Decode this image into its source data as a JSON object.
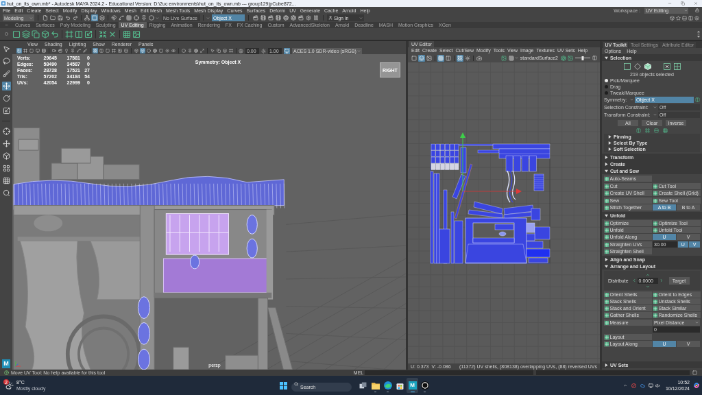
{
  "title_bar": {
    "title": "hut_on_its_own.mb* - Autodesk MAYA 2024.2 - Educational Version: D:\\2uc environments\\hut_on_its_own.mb --- group129|pCube872..."
  },
  "menu_bar": {
    "items": [
      "File",
      "Edit",
      "Create",
      "Select",
      "Modify",
      "Display",
      "Windows",
      "Mesh",
      "Edit Mesh",
      "Mesh Tools",
      "Mesh Display",
      "Curves",
      "Surfaces",
      "Deform",
      "UV",
      "Generate",
      "Cache",
      "Arnold",
      "Help"
    ],
    "workspace": {
      "label": "Workspace :",
      "value": "UV Editing"
    }
  },
  "status_line": {
    "mode": "Modeling",
    "tool_groups": [
      [
        {
          "kind": "file",
          "selected": false
        },
        {
          "kind": "folder",
          "selected": false
        },
        {
          "kind": "save",
          "selected": false
        },
        {
          "kind": "undo",
          "selected": false
        },
        {
          "kind": "redo",
          "selected": false
        }
      ],
      [
        {
          "kind": "hierarchy",
          "selected": false
        },
        {
          "kind": "square",
          "selected": true
        },
        {
          "kind": "layers",
          "selected": false
        }
      ],
      [
        {
          "kind": "magnet",
          "selected": false
        },
        {
          "kind": "spline",
          "selected": false
        },
        {
          "kind": "grid",
          "selected": false
        },
        {
          "kind": "crosshair",
          "selected": false
        },
        {
          "kind": "pin",
          "selected": false
        },
        {
          "kind": "circle",
          "selected": false
        }
      ]
    ],
    "live_surface": "No Live Surface",
    "symmetry": "Object X",
    "render_groups": [
      [
        {
          "kind": "clapper",
          "selected": false
        },
        {
          "kind": "film",
          "selected": false
        },
        {
          "kind": "clapper",
          "selected": false
        },
        {
          "kind": "film",
          "selected": false
        },
        {
          "kind": "aperture",
          "selected": false
        },
        {
          "kind": "aperture",
          "selected": false
        },
        {
          "kind": "clapper",
          "selected": false
        },
        {
          "kind": "gear",
          "selected": false
        },
        {
          "kind": "pause",
          "selected": false
        }
      ]
    ],
    "account": "Sign in"
  },
  "shelf": {
    "tabs": [
      {
        "label": "Curves",
        "selected": false
      },
      {
        "label": "Surfaces",
        "selected": false
      },
      {
        "label": "Poly Modeling",
        "selected": false
      },
      {
        "label": "Sculpting",
        "selected": false
      },
      {
        "label": "UV Editing",
        "selected": true
      },
      {
        "label": "Rigging",
        "selected": false
      },
      {
        "label": "Animation",
        "selected": false
      },
      {
        "label": "Rendering",
        "selected": false
      },
      {
        "label": "FX",
        "selected": false
      },
      {
        "label": "FX Caching",
        "selected": false
      },
      {
        "label": "Custom",
        "selected": false
      },
      {
        "label": "AdvancedSkeleton",
        "selected": false
      },
      {
        "label": "Arnold",
        "selected": false
      },
      {
        "label": "Deadline",
        "selected": false
      },
      {
        "label": "MASH",
        "selected": false
      },
      {
        "label": "Motion Graphics",
        "selected": false
      },
      {
        "label": "XGen",
        "selected": false
      }
    ]
  },
  "toolbox": {
    "tool_groups": [
      [
        {
          "kind": "pointer",
          "selected": false
        },
        {
          "kind": "lasso",
          "selected": false
        },
        {
          "kind": "brush",
          "selected": false
        },
        {
          "kind": "move",
          "selected": true
        },
        {
          "kind": "rotate",
          "selected": false
        },
        {
          "kind": "scale",
          "selected": false
        }
      ],
      [
        {
          "kind": "crosshair",
          "selected": false
        },
        {
          "kind": "move",
          "selected": false
        },
        {
          "kind": "cube",
          "selected": false
        },
        {
          "kind": "layout",
          "selected": false
        },
        {
          "kind": "grid",
          "selected": false
        },
        {
          "kind": "search",
          "selected": false
        }
      ]
    ],
    "logo_letter": "M"
  },
  "viewport": {
    "menu": [
      "View",
      "Shading",
      "Lighting",
      "Show",
      "Renderer",
      "Panels"
    ],
    "tool_groups": [
      [
        {
          "kind": "image",
          "selected": true
        },
        {
          "kind": "frame",
          "selected": false
        },
        {
          "kind": "square",
          "selected": false
        },
        {
          "kind": "monitor",
          "selected": false
        },
        {
          "kind": "film",
          "selected": false
        }
      ],
      [
        {
          "kind": "video",
          "selected": false
        },
        {
          "kind": "clapper",
          "selected": false
        },
        {
          "kind": "bulb",
          "selected": false
        },
        {
          "kind": "pin",
          "selected": false
        },
        {
          "kind": "spline",
          "selected": false
        },
        {
          "kind": "brush",
          "selected": false
        }
      ],
      [
        {
          "kind": "layout",
          "selected": true
        },
        {
          "kind": "columns",
          "selected": false
        },
        {
          "kind": "square",
          "selected": false
        },
        {
          "kind": "frame",
          "selected": false
        },
        {
          "kind": "image",
          "selected": false
        },
        {
          "kind": "rows",
          "selected": false
        }
      ],
      [
        {
          "kind": "cube",
          "selected": false
        },
        {
          "kind": "cube",
          "selected": true
        },
        {
          "kind": "circle",
          "selected": false
        },
        {
          "kind": "aperture",
          "selected": false
        },
        {
          "kind": "square",
          "selected": false
        },
        {
          "kind": "sun",
          "selected": false
        },
        {
          "kind": "eye",
          "selected": false
        }
      ],
      [
        {
          "kind": "circle",
          "selected": false
        },
        {
          "kind": "pin",
          "selected": false
        },
        {
          "kind": "aperture",
          "selected": false
        },
        {
          "kind": "maximize",
          "selected": false
        }
      ],
      [
        {
          "kind": "pointer",
          "selected": false
        },
        {
          "kind": "copy",
          "selected": false
        },
        {
          "kind": "layers",
          "selected": false
        },
        {
          "kind": "frame",
          "selected": false
        }
      ]
    ],
    "exposure": "0.00",
    "gamma": "1.00",
    "color_management": {
      "on": true,
      "value": "ACES 1.0 SDR-video (sRGB)"
    },
    "hud": [
      {
        "label": "Verts:",
        "values": [
          "29645",
          "17581",
          "0"
        ]
      },
      {
        "label": "Edges:",
        "values": [
          "58490",
          "34587",
          "0"
        ]
      },
      {
        "label": "Faces:",
        "values": [
          "28728",
          "17521",
          "27"
        ]
      },
      {
        "label": "Tris:",
        "values": [
          "57202",
          "34184",
          "54"
        ]
      },
      {
        "label": "UVs:",
        "values": [
          "42054",
          "22999",
          "0"
        ]
      }
    ],
    "symmetry": "Symmetry: Object X",
    "view_cube": "RIGHT",
    "camera": "persp"
  },
  "uv_editor": {
    "tab": "UV Editor",
    "menu": [
      "Edit",
      "Create",
      "Select",
      "Cut/Sew",
      "Modify",
      "Tools",
      "View",
      "Image",
      "Textures",
      "UV Sets",
      "Help"
    ],
    "tool_groups": [
      [
        {
          "kind": "square",
          "selected": false
        },
        {
          "kind": "layers",
          "selected": true
        },
        {
          "kind": "image",
          "selected": false
        }
      ],
      [
        {
          "kind": "grid",
          "selected": true
        },
        {
          "kind": "columns",
          "selected": false
        }
      ],
      [
        {
          "kind": "layout",
          "selected": true
        },
        {
          "kind": "sun",
          "selected": false
        }
      ],
      [
        {
          "kind": "camera",
          "selected": false
        }
      ]
    ],
    "material": "standardSurface2",
    "brightness": {
      "level": 0.5
    },
    "u_coordinate": "U: 0.373",
    "v_coordinate": "V: -0.086",
    "info": "(11372) UV shells, (808138) overlapping UVs, (88) reversed UVs"
  },
  "uv_toolkit": {
    "tabs": [
      {
        "label": "UV Toolkit",
        "selected": true
      },
      {
        "label": "Tool Settings",
        "selected": false
      },
      {
        "label": "Attribute Editor",
        "selected": false
      }
    ],
    "menu": [
      "Options",
      "Help"
    ],
    "selection": {
      "title": "Selection",
      "expanded": true,
      "modes": [
        {
          "kind": "square",
          "selected": false
        },
        {
          "kind": "diamond",
          "selected": false
        },
        {
          "kind": "cube",
          "selected": true
        },
        {
          "kind": "shell",
          "selected": false
        },
        {
          "kind": "grid",
          "selected": false
        }
      ],
      "status": "219 objects selected",
      "pick_modes": [
        {
          "label": "Pick/Marquee",
          "selected": true
        },
        {
          "label": "Drag",
          "selected": false
        },
        {
          "label": "Tweak/Marquee",
          "selected": false
        }
      ],
      "symmetry": {
        "label": "Symmetry:",
        "value": "Object X"
      },
      "constraints": [
        {
          "label": "Selection Constraint:",
          "value": "Off"
        },
        {
          "label": "Transform Constraint:",
          "value": "Off"
        }
      ],
      "buttons": [
        "All",
        "Clear",
        "Inverse"
      ],
      "subsections": [
        {
          "title": "Pinning",
          "expanded": false
        },
        {
          "title": "Select By Type",
          "expanded": false
        },
        {
          "title": "Soft Selection",
          "expanded": false
        }
      ]
    },
    "sections": [
      {
        "title": "Transform",
        "expanded": false
      },
      {
        "title": "Create",
        "expanded": false
      },
      {
        "title": "Cut and Sew",
        "expanded": true,
        "groups": [
          [
            [
              {
                "kind": "tool",
                "label": "Auto-Seams"
              }
            ]
          ],
          [
            [
              {
                "kind": "tool",
                "label": "Cut"
              },
              {
                "kind": "tool",
                "label": "Cut Tool"
              }
            ],
            [
              {
                "kind": "tool",
                "label": "Create UV Shell"
              },
              {
                "kind": "tool",
                "label": "Create Shell (Grid)"
              }
            ]
          ],
          [
            [
              {
                "kind": "tool",
                "label": "Sew"
              },
              {
                "kind": "tool",
                "label": "Sew Tool"
              }
            ],
            [
              {
                "kind": "tool",
                "label": "Stitch Together"
              },
              {
                "kind": "toggle",
                "label": "A to B",
                "selected": true
              },
              {
                "kind": "toggle",
                "label": "B to A",
                "selected": false
              }
            ]
          ]
        ]
      },
      {
        "title": "Unfold",
        "expanded": true,
        "groups": [
          [
            [
              {
                "kind": "tool",
                "label": "Optimize"
              },
              {
                "kind": "tool",
                "label": "Optimize Tool"
              }
            ],
            [
              {
                "kind": "tool",
                "label": "Unfold"
              },
              {
                "kind": "tool",
                "label": "Unfold Tool"
              }
            ],
            [
              {
                "kind": "tool",
                "label": "Unfold Along"
              },
              {
                "kind": "toggle",
                "label": "U",
                "selected": true
              },
              {
                "kind": "toggle",
                "label": "V",
                "selected": false
              }
            ]
          ],
          [
            [
              {
                "kind": "tool",
                "label": "Straighten UVs"
              },
              {
                "kind": "field",
                "value": "30.00"
              },
              {
                "kind": "toggle",
                "label": "U",
                "selected": true
              },
              {
                "kind": "toggle",
                "label": "V",
                "selected": true
              }
            ],
            [
              {
                "kind": "tool",
                "label": "Straighten Shell"
              }
            ]
          ]
        ]
      },
      {
        "title": "Align and Snap",
        "expanded": false
      },
      {
        "title": "Arrange and Layout",
        "expanded": true,
        "groups": [
          [
            [
              {
                "kind": "distribute",
                "label": "Distribute",
                "value": "0.0000",
                "button": "Target"
              }
            ]
          ],
          [
            [
              {
                "kind": "tool",
                "label": "Orient Shells"
              },
              {
                "kind": "tool",
                "label": "Orient to Edges"
              }
            ],
            [
              {
                "kind": "tool",
                "label": "Stack Shells"
              },
              {
                "kind": "tool",
                "label": "Unstack Shells"
              }
            ],
            [
              {
                "kind": "tool",
                "label": "Stack and Orient"
              },
              {
                "kind": "tool",
                "label": "Stack Similar"
              }
            ],
            [
              {
                "kind": "tool",
                "label": "Gather Shells"
              },
              {
                "kind": "tool",
                "label": "Randomize Shells"
              }
            ]
          ],
          [
            [
              {
                "kind": "tool",
                "label": "Measure"
              },
              {
                "kind": "dropdown",
                "label": "Pixel Distance"
              }
            ],
            [
              {
                "kind": "blank"
              },
              {
                "kind": "field",
                "value": "0"
              }
            ]
          ],
          [
            [
              {
                "kind": "tool",
                "label": "Layout"
              }
            ],
            [
              {
                "kind": "tool",
                "label": "Layout Along"
              },
              {
                "kind": "toggle",
                "label": "U",
                "selected": true
              },
              {
                "kind": "toggle",
                "label": "V",
                "selected": false
              }
            ]
          ]
        ]
      }
    ],
    "footer": {
      "title": "UV Sets",
      "expanded": false
    }
  },
  "help_line": {
    "message": "Move UV Tool: No help available for this tool",
    "command_language": "MEL"
  },
  "taskbar": {
    "weather": {
      "badge": "2",
      "temperature": "8°C",
      "condition": "Mostly cloudy"
    },
    "search": {
      "placeholder": "Search"
    },
    "apps": [
      {
        "kind": "task_view",
        "open": false,
        "selected": false
      },
      {
        "kind": "folder",
        "open": true,
        "selected": false
      },
      {
        "kind": "browser",
        "open": true,
        "selected": false
      },
      {
        "kind": "store",
        "open": false,
        "selected": false
      },
      {
        "kind": "maya",
        "label": "M",
        "open": true,
        "selected": true
      },
      {
        "kind": "engine",
        "open": true,
        "selected": false
      }
    ],
    "time": "10:52",
    "date": "10/12/2024"
  }
}
